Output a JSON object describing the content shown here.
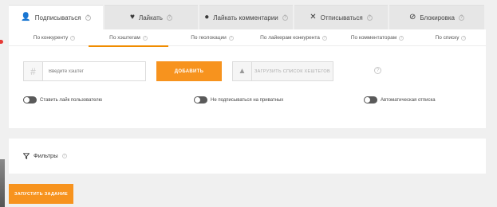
{
  "tabs": [
    {
      "label": "Подписываться",
      "icon": "user-icon",
      "active": true
    },
    {
      "label": "Лайкать",
      "icon": "heart-icon",
      "active": false
    },
    {
      "label": "Лайкать комментарии",
      "icon": "comment-icon",
      "active": false
    },
    {
      "label": "Отписываться",
      "icon": "close-icon",
      "active": false
    },
    {
      "label": "Блокировка",
      "icon": "ban-icon",
      "active": false
    }
  ],
  "subtabs": [
    {
      "label": "По конкуренту"
    },
    {
      "label": "По хэштегам"
    },
    {
      "label": "По геолокации"
    },
    {
      "label": "По лайкерам конкурента"
    },
    {
      "label": "По комментаторам"
    },
    {
      "label": "По списку"
    }
  ],
  "hashtag": {
    "placeholder": "Введите хэштег",
    "value": "",
    "add_label": "ДОБАВИТЬ",
    "upload_label": "ЗАГРУЗИТЬ СПИСОК ХЕШТЕГОВ"
  },
  "toggles": [
    {
      "label": "Ставить лайк пользователю",
      "on": false
    },
    {
      "label": "Не подписываться на приватных",
      "on": false
    },
    {
      "label": "Автоматическая отписка",
      "on": false
    }
  ],
  "filters": {
    "label": "Фильтры"
  },
  "run_label": "ЗАПУСТИТЬ ЗАДАНИЕ",
  "colors": {
    "accent": "#f7931e",
    "active_icon": "#4a7fd4"
  }
}
